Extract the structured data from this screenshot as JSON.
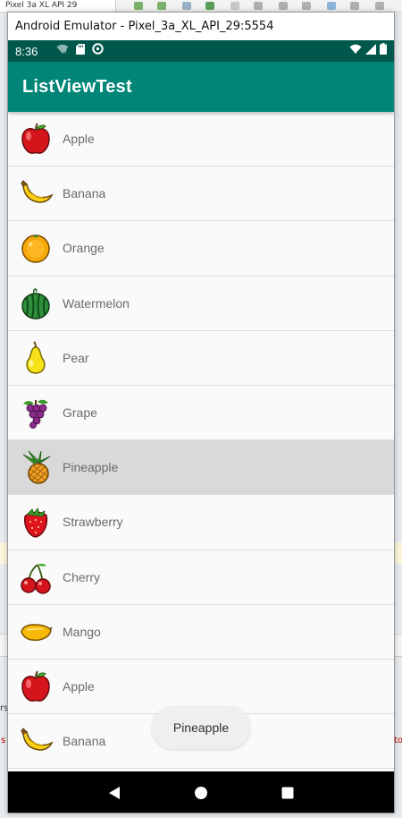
{
  "host": {
    "tab_title": "Pixel 3a XL API 29",
    "side_letters": [
      "rs",
      "s",
      "to"
    ]
  },
  "window": {
    "title": "Android Emulator - Pixel_3a_XL_API_29:5554"
  },
  "status_bar": {
    "time": "8:36",
    "left_icons": [
      "wifi-question-icon",
      "sd-card-icon",
      "data-saver-icon"
    ],
    "right_icons": [
      "wifi-icon",
      "signal-icon",
      "battery-icon"
    ]
  },
  "app_bar": {
    "title": "ListViewTest",
    "color": "#008577",
    "status_color": "#00574b"
  },
  "list": {
    "items": [
      {
        "label": "Apple",
        "icon": "apple-icon"
      },
      {
        "label": "Banana",
        "icon": "banana-icon"
      },
      {
        "label": "Orange",
        "icon": "orange-icon"
      },
      {
        "label": "Watermelon",
        "icon": "watermelon-icon"
      },
      {
        "label": "Pear",
        "icon": "pear-icon"
      },
      {
        "label": "Grape",
        "icon": "grape-icon"
      },
      {
        "label": "Pineapple",
        "icon": "pineapple-icon",
        "pressed": true
      },
      {
        "label": "Strawberry",
        "icon": "strawberry-icon"
      },
      {
        "label": "Cherry",
        "icon": "cherry-icon"
      },
      {
        "label": "Mango",
        "icon": "mango-icon"
      },
      {
        "label": "Apple",
        "icon": "apple-icon"
      },
      {
        "label": "Banana",
        "icon": "banana-icon"
      }
    ]
  },
  "toast": {
    "text": "Pineapple"
  },
  "nav_bar": {
    "buttons": [
      "back-icon",
      "home-icon",
      "recents-icon"
    ]
  }
}
